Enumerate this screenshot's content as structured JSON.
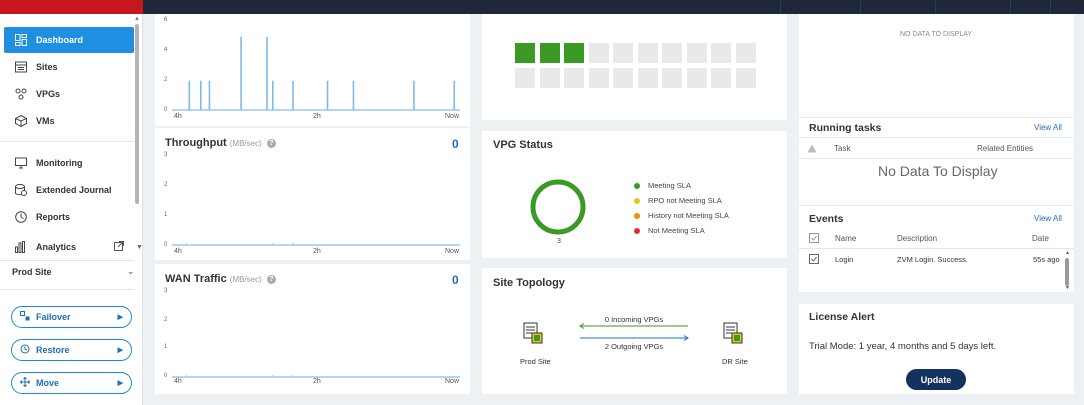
{
  "sidebar": {
    "items": [
      {
        "label": "Dashboard",
        "icon": "dashboard-icon"
      },
      {
        "label": "Sites",
        "icon": "sites-icon"
      },
      {
        "label": "VPGs",
        "icon": "vpgs-icon"
      },
      {
        "label": "VMs",
        "icon": "vms-icon"
      },
      {
        "label": "Monitoring",
        "icon": "monitor-icon"
      },
      {
        "label": "Extended Journal",
        "icon": "journal-icon"
      },
      {
        "label": "Reports",
        "icon": "clock-icon"
      },
      {
        "label": "Analytics",
        "icon": "bar-chart-icon"
      }
    ],
    "site_select": "Prod Site",
    "actions": [
      {
        "label": "Failover",
        "icon": "failover-icon"
      },
      {
        "label": "Restore",
        "icon": "restore-icon"
      },
      {
        "label": "Move",
        "icon": "move-icon"
      }
    ]
  },
  "iops_chart": {
    "y_ticks": [
      "6",
      "4",
      "2",
      "0"
    ],
    "x_ticks": [
      "4h",
      "2h",
      "Now"
    ],
    "ylim": [
      0,
      6
    ],
    "spikes": [
      {
        "t": 0.06,
        "v": 2
      },
      {
        "t": 0.1,
        "v": 2
      },
      {
        "t": 0.13,
        "v": 2
      },
      {
        "t": 0.24,
        "v": 5
      },
      {
        "t": 0.33,
        "v": 5
      },
      {
        "t": 0.35,
        "v": 2
      },
      {
        "t": 0.42,
        "v": 2
      },
      {
        "t": 0.54,
        "v": 2
      },
      {
        "t": 0.63,
        "v": 2
      },
      {
        "t": 0.84,
        "v": 2
      },
      {
        "t": 0.98,
        "v": 2
      }
    ]
  },
  "throughput": {
    "title": "Throughput",
    "unit": "(MB/sec)",
    "value": "0",
    "y_ticks": [
      "3",
      "2",
      "1",
      "0"
    ],
    "x_ticks": [
      "4h",
      "2h",
      "Now"
    ],
    "ylim": [
      0,
      3
    ]
  },
  "wan_traffic": {
    "title": "WAN Traffic",
    "unit": "(MB/sec)",
    "value": "0",
    "y_ticks": [
      "3",
      "2",
      "1",
      "0"
    ],
    "x_ticks": [
      "4h",
      "2h",
      "Now"
    ],
    "ylim": [
      0,
      3
    ]
  },
  "vpg_grid": {
    "total": 20,
    "active": 3
  },
  "vpg_status": {
    "title": "VPG Status",
    "count": "3",
    "legend": [
      {
        "label": "Meeting SLA",
        "color": "#3a9a23"
      },
      {
        "label": "RPO not Meeting SLA",
        "color": "#f0c419"
      },
      {
        "label": "History not Meeting SLA",
        "color": "#f29100"
      },
      {
        "label": "Not Meeting SLA",
        "color": "#d9342b"
      }
    ]
  },
  "site_topology": {
    "title": "Site Topology",
    "incoming": "0 Incoming VPGs",
    "outgoing": "2 Outgoing VPGs",
    "source": "Prod Site",
    "target": "DR Site"
  },
  "alerts_panel": {
    "no_data": "NO DATA TO DISPLAY"
  },
  "running_tasks": {
    "title": "Running tasks",
    "view_all": "View All",
    "col_task": "Task",
    "col_related": "Related Entities",
    "no_data": "No Data To Display"
  },
  "events": {
    "title": "Events",
    "view_all": "View All",
    "col_name": "Name",
    "col_desc": "Description",
    "col_date": "Date",
    "rows": [
      {
        "name": "Login",
        "description": "ZVM Login. Success.",
        "date": "55s ago"
      }
    ]
  },
  "license": {
    "title": "License Alert",
    "text": "Trial Mode: 1 year, 4 months and 5 days left.",
    "button": "Update"
  }
}
